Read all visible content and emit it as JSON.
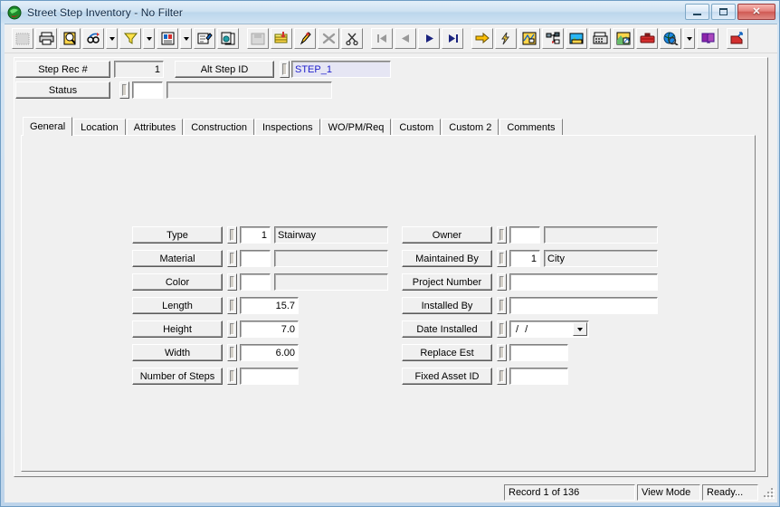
{
  "window": {
    "title": "Street Step Inventory - No Filter",
    "app_icon": "app-globe-icon",
    "minimize_label": "Minimize",
    "maximize_label": "Maximize",
    "close_label": "✕"
  },
  "toolbar": {
    "items": [
      {
        "name": "select-tool-icon",
        "kind": "button",
        "enabled": false
      },
      {
        "name": "print-icon",
        "kind": "button",
        "enabled": true
      },
      {
        "name": "print-preview-icon",
        "kind": "button",
        "enabled": true
      },
      {
        "name": "find-icon",
        "kind": "button",
        "enabled": true
      },
      {
        "name": "find-dropdown-arrow",
        "kind": "arrow",
        "enabled": true
      },
      {
        "name": "filter-funnel-icon",
        "kind": "button",
        "enabled": true
      },
      {
        "name": "filter-dropdown-arrow",
        "kind": "arrow",
        "enabled": true
      },
      {
        "name": "report-icon",
        "kind": "button",
        "enabled": true
      },
      {
        "name": "report-dropdown-arrow",
        "kind": "arrow",
        "enabled": true
      },
      {
        "name": "form-designer-icon",
        "kind": "button",
        "enabled": true
      },
      {
        "name": "copy-record-icon",
        "kind": "button",
        "enabled": true
      },
      {
        "name": "separator",
        "kind": "sep"
      },
      {
        "name": "save-icon",
        "kind": "button",
        "enabled": false
      },
      {
        "name": "new-record-icon",
        "kind": "button",
        "enabled": true
      },
      {
        "name": "edit-pencil-icon",
        "kind": "button",
        "enabled": true
      },
      {
        "name": "delete-x-icon",
        "kind": "button",
        "enabled": false
      },
      {
        "name": "cut-scissors-icon",
        "kind": "button",
        "enabled": true
      },
      {
        "name": "separator",
        "kind": "sep"
      },
      {
        "name": "first-record-icon",
        "kind": "button",
        "enabled": false
      },
      {
        "name": "previous-record-icon",
        "kind": "button",
        "enabled": false
      },
      {
        "name": "next-record-icon",
        "kind": "button",
        "enabled": true
      },
      {
        "name": "last-record-icon",
        "kind": "button",
        "enabled": true
      },
      {
        "name": "separator",
        "kind": "sep"
      },
      {
        "name": "goto-arrow-icon",
        "kind": "button",
        "enabled": true
      },
      {
        "name": "quick-action-bolt-icon",
        "kind": "button",
        "enabled": true
      },
      {
        "name": "map-layers-icon",
        "kind": "button",
        "enabled": true
      },
      {
        "name": "tree-view-icon",
        "kind": "button",
        "enabled": true
      },
      {
        "name": "image-attach-icon",
        "kind": "button",
        "enabled": true
      },
      {
        "name": "fax-icon",
        "kind": "button",
        "enabled": true
      },
      {
        "name": "gis-map-icon",
        "kind": "button",
        "enabled": true
      },
      {
        "name": "toolbox-icon",
        "kind": "button",
        "enabled": true
      },
      {
        "name": "globe-search-icon",
        "kind": "button",
        "enabled": true
      },
      {
        "name": "globe-dropdown-arrow",
        "kind": "arrow",
        "enabled": true
      },
      {
        "name": "help-book-icon",
        "kind": "button",
        "enabled": true
      },
      {
        "name": "separator",
        "kind": "sep"
      },
      {
        "name": "exit-icon",
        "kind": "button",
        "enabled": true
      }
    ]
  },
  "header": {
    "step_rec_label": "Step Rec #",
    "step_rec_value": "1",
    "alt_step_label": "Alt Step ID",
    "alt_step_value": "STEP_1",
    "status_label": "Status",
    "status_code": "",
    "status_desc": ""
  },
  "tabs": [
    {
      "label": "General",
      "active": true
    },
    {
      "label": "Location",
      "active": false
    },
    {
      "label": "Attributes",
      "active": false
    },
    {
      "label": "Construction",
      "active": false
    },
    {
      "label": "Inspections",
      "active": false
    },
    {
      "label": "WO/PM/Req",
      "active": false
    },
    {
      "label": "Custom",
      "active": false
    },
    {
      "label": "Custom 2",
      "active": false
    },
    {
      "label": "Comments",
      "active": false
    }
  ],
  "form": {
    "left": [
      {
        "label": "Type",
        "code": "1",
        "desc": "Stairway",
        "layout": "code_desc"
      },
      {
        "label": "Material",
        "code": "",
        "desc": "",
        "layout": "code_desc"
      },
      {
        "label": "Color",
        "code": "",
        "desc": "",
        "layout": "code_desc"
      },
      {
        "label": "Length",
        "value": "15.7",
        "layout": "number"
      },
      {
        "label": "Height",
        "value": "7.0",
        "layout": "number"
      },
      {
        "label": "Width",
        "value": "6.00",
        "layout": "number"
      },
      {
        "label": "Number of Steps",
        "value": "",
        "layout": "number"
      }
    ],
    "right": [
      {
        "label": "Owner",
        "code": "",
        "desc": "",
        "layout": "code_desc"
      },
      {
        "label": "Maintained By",
        "code": "1",
        "desc": "City",
        "layout": "code_desc"
      },
      {
        "label": "Project Number",
        "value": "",
        "layout": "wide"
      },
      {
        "label": "Installed By",
        "value": "",
        "layout": "wide"
      },
      {
        "label": "Date Installed",
        "value": "/  /",
        "layout": "date"
      },
      {
        "label": "Replace Est",
        "value": "",
        "layout": "number"
      },
      {
        "label": "Fixed Asset ID",
        "value": "",
        "layout": "number"
      }
    ]
  },
  "statusbar": {
    "record": "Record 1 of 136",
    "mode": "View Mode",
    "state": "Ready..."
  },
  "colors": {
    "face": "#f0f0f0",
    "title_start": "#e4eff9",
    "title_end": "#bcd6ec",
    "frame": "#6f9dc4",
    "alt_field_bg": "#e6e6f4",
    "alt_field_fg": "#2222cc",
    "close_button": "#cf5a54"
  }
}
